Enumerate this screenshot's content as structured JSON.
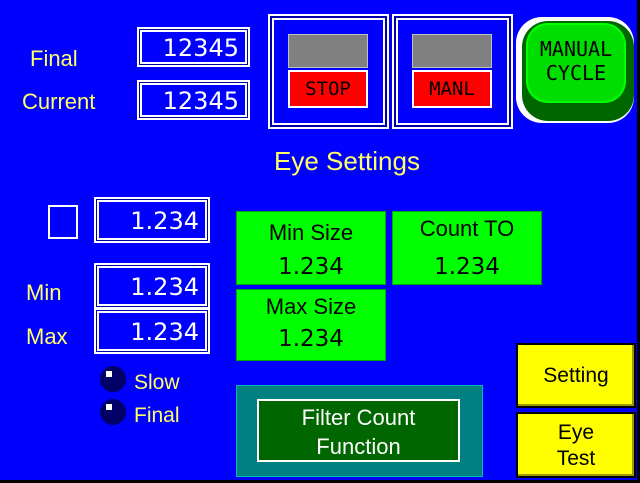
{
  "title": "Eye Settings",
  "labels": {
    "final": "Final",
    "current": "Current",
    "min": "Min",
    "max": "Max"
  },
  "counters": {
    "final_value": "12345",
    "current_value": "12345"
  },
  "status": {
    "stop_label": "STOP",
    "manual_label": "MANL"
  },
  "manual_cycle": {
    "line1": "MANUAL",
    "line2": "CYCLE"
  },
  "fields": {
    "top_value": "1.234",
    "min_value": "1.234",
    "max_value": "1.234"
  },
  "radio": {
    "slow_label": "Slow",
    "final_label": "Final"
  },
  "settings": {
    "min_size_label": "Min Size",
    "min_size_value": "1.234",
    "count_to_label": "Count TO",
    "count_to_value": "1.234",
    "max_size_label": "Max Size",
    "max_size_value": "1.234"
  },
  "filter_button": {
    "line1": "Filter Count",
    "line2": "Function"
  },
  "buttons": {
    "setting": "Setting",
    "eye_test_line1": "Eye",
    "eye_test_line2": "Test"
  },
  "colors": {
    "background": "#0000ff",
    "label": "#ffff66",
    "green": "#00ff00",
    "dark_green": "#006600",
    "red": "#ff0000",
    "yellow": "#ffff00",
    "teal": "#008080"
  }
}
